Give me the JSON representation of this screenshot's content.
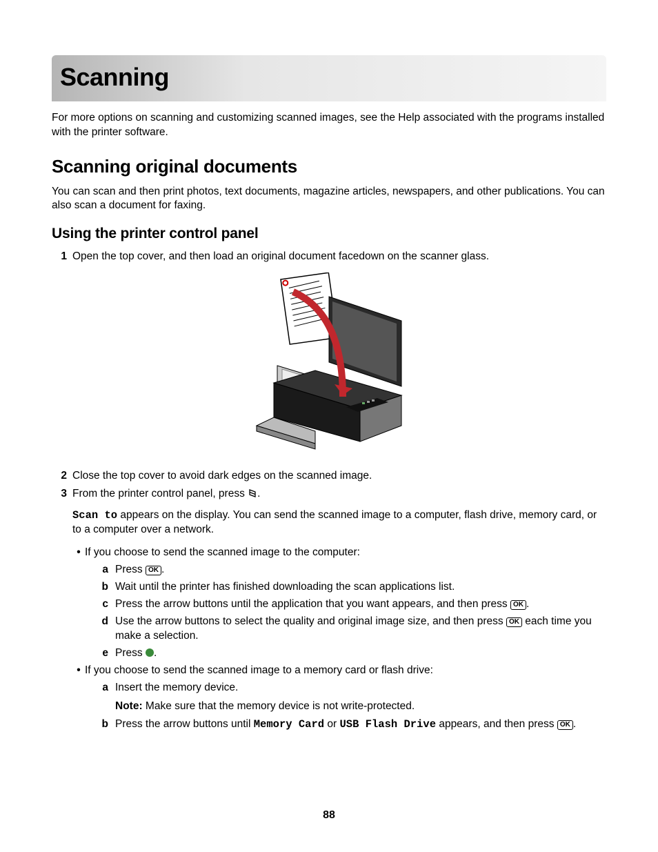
{
  "title": "Scanning",
  "intro": "For more options on scanning and customizing scanned images, see the Help associated with the programs installed with the printer software.",
  "h2": "Scanning original documents",
  "p2": "You can scan and then print photos, text documents, magazine articles, newspapers, and other publications. You can also scan a document for faxing.",
  "h3": "Using the printer control panel",
  "steps": {
    "s1": "Open the top cover, and then load an original document facedown on the scanner glass.",
    "s2": "Close the top cover to avoid dark edges on the scanned image.",
    "s3_pre": "From the printer control panel, press ",
    "s3_post": ".",
    "s3_desc_pre": "Scan to",
    "s3_desc_post": " appears on the display. You can send the scanned image to a computer, flash drive, memory card, or to a computer over a network.",
    "bullet1": "If you choose to send the scanned image to the computer:",
    "a_pre": "Press ",
    "a_post": ".",
    "b": "Wait until the printer has finished downloading the scan applications list.",
    "c_pre": "Press the arrow buttons until the application that you want appears, and then press ",
    "c_post": ".",
    "d_pre": "Use the arrow buttons to select the quality and original image size, and then press ",
    "d_post": " each time you make a selection.",
    "e_pre": "Press ",
    "e_post": ".",
    "bullet2": "If you choose to send the scanned image to a memory card or flash drive:",
    "a2": "Insert the memory device.",
    "note_label": "Note:",
    "note": " Make sure that the memory device is not write-protected.",
    "b2_pre": "Press the arrow buttons until ",
    "b2_mid1": "Memory Card",
    "b2_or": " or ",
    "b2_mid2": "USB Flash Drive",
    "b2_post1": " appears, and then press ",
    "b2_post2": "."
  },
  "ok_label": "OK",
  "page_number": "88"
}
